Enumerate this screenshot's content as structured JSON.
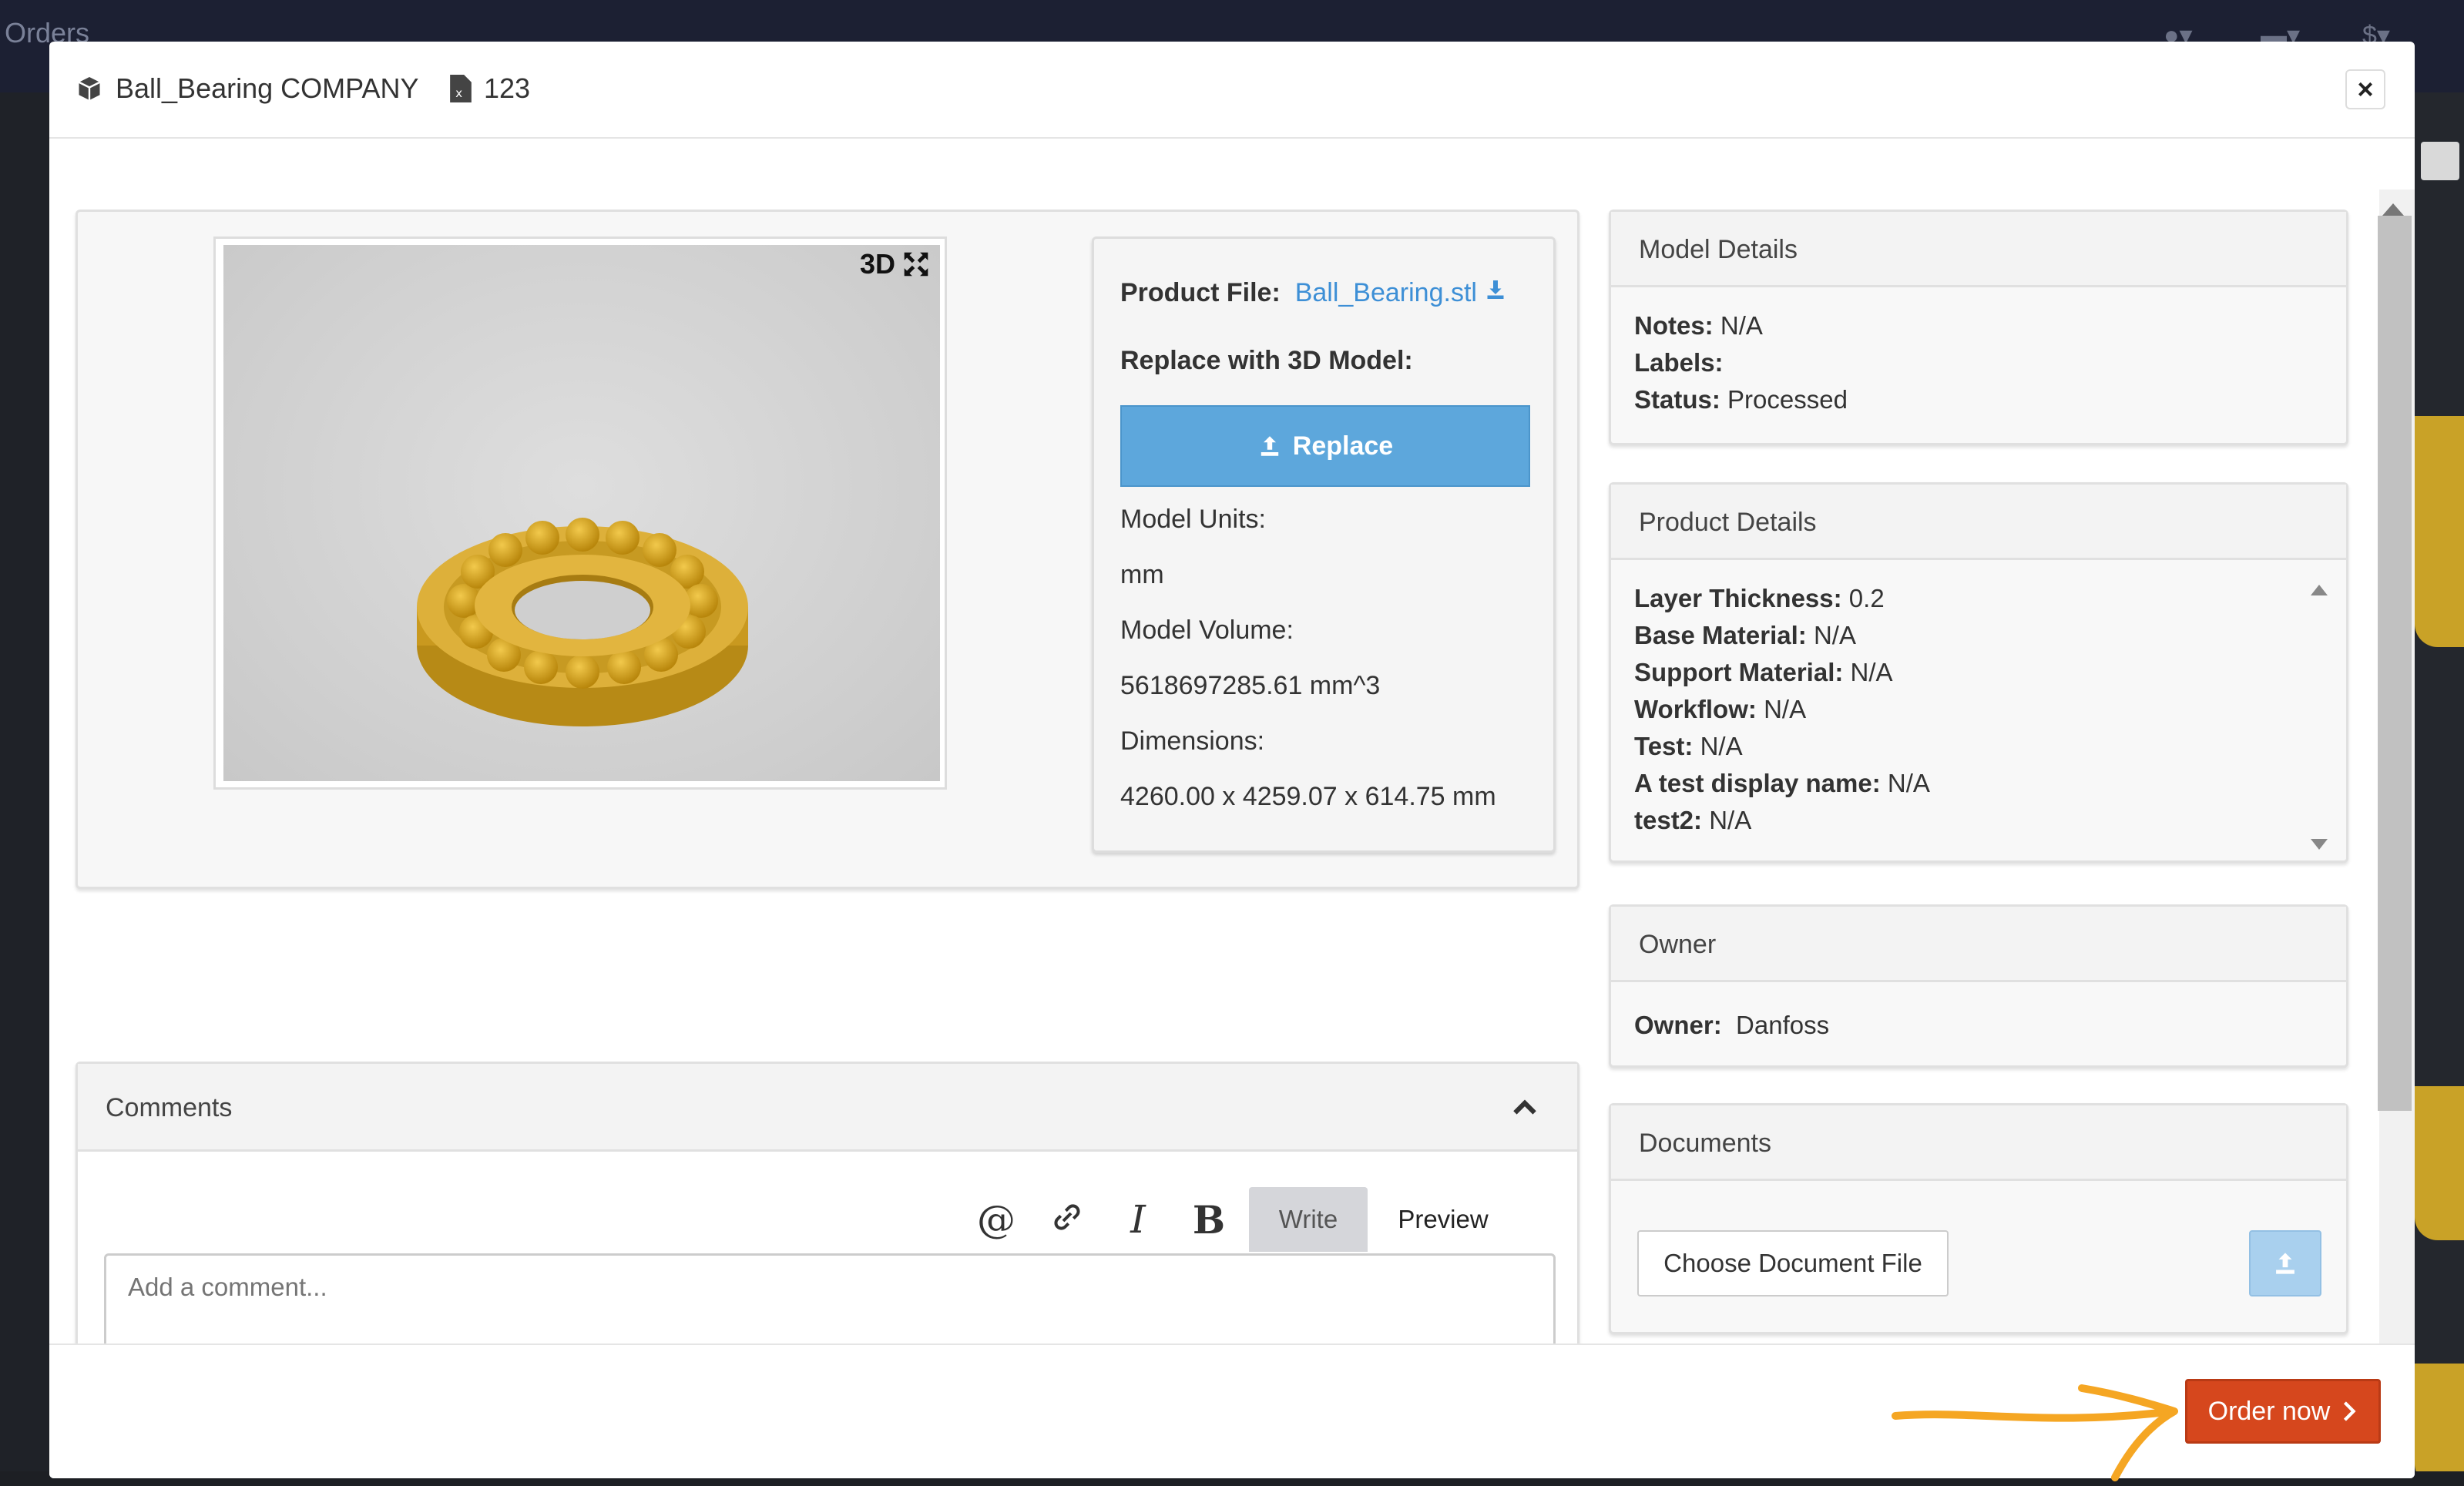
{
  "background": {
    "app_title": "Orders"
  },
  "modal": {
    "title": "Ball_Bearing COMPANY",
    "file_badge": "123",
    "close_label": "×"
  },
  "viewer": {
    "mode_label": "3D",
    "product_color": "#d4a22a"
  },
  "product_info": {
    "product_file_label": "Product File:",
    "product_file_name": "Ball_Bearing.stl",
    "replace_label": "Replace with 3D Model:",
    "replace_button": "Replace",
    "units_label": "Model Units:",
    "units_value": "mm",
    "volume_label": "Model Volume:",
    "volume_value": "5618697285.61 mm^3",
    "dimensions_label": "Dimensions:",
    "dimensions_value": "4260.00 x 4259.07 x 614.75 mm"
  },
  "model_details": {
    "title": "Model Details",
    "notes_label": "Notes:",
    "notes_value": "N/A",
    "labels_label": "Labels:",
    "labels_value": "",
    "status_label": "Status:",
    "status_value": "Processed"
  },
  "product_details": {
    "title": "Product Details",
    "rows": [
      {
        "label": "Layer Thickness:",
        "value": "0.2"
      },
      {
        "label": "Base Material:",
        "value": "N/A"
      },
      {
        "label": "Support Material:",
        "value": "N/A"
      },
      {
        "label": "Workflow:",
        "value": "N/A"
      },
      {
        "label": "Test:",
        "value": "N/A"
      },
      {
        "label": "A test display name:",
        "value": "N/A"
      },
      {
        "label": "test2:",
        "value": "N/A"
      }
    ]
  },
  "owner": {
    "title": "Owner",
    "label": "Owner:",
    "value": "Danfoss"
  },
  "documents": {
    "title": "Documents",
    "choose_button": "Choose Document File"
  },
  "comments": {
    "title": "Comments",
    "mention_icon": "@",
    "italic_icon": "I",
    "bold_icon": "B",
    "write_tab": "Write",
    "preview_tab": "Preview",
    "placeholder": "Add a comment..."
  },
  "footer": {
    "order_button": "Order now",
    "accent_color": "#d6471d",
    "annotation_color": "#f5a623"
  }
}
